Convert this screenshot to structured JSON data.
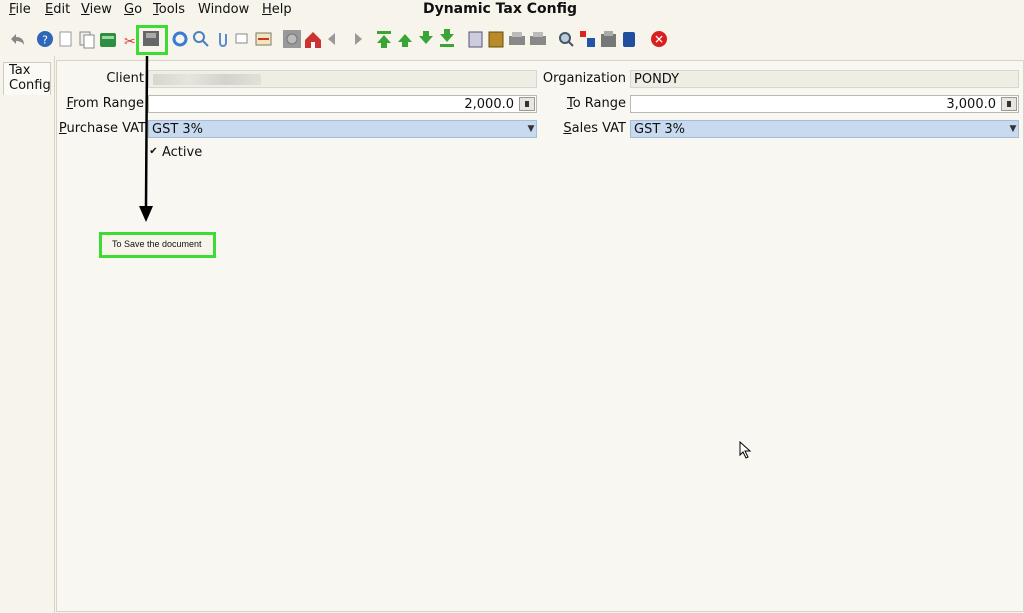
{
  "menubar": {
    "items": [
      {
        "u": "F",
        "rest": "ile"
      },
      {
        "u": "E",
        "rest": "dit"
      },
      {
        "u": "V",
        "rest": "iew"
      },
      {
        "u": "G",
        "rest": "o"
      },
      {
        "u": "T",
        "rest": "ools"
      },
      {
        "u": "",
        "rest": "Window"
      },
      {
        "u": "H",
        "rest": "elp"
      }
    ],
    "title": "Dynamic Tax Config"
  },
  "sidebar": {
    "tab_line1": "Tax",
    "tab_line2": "Config"
  },
  "form": {
    "client_label": "Client",
    "organization_label": "Organization",
    "organization_value": "PONDY",
    "from_range_u": "F",
    "from_range_rest": "rom Range",
    "from_range_value": "2,000.0",
    "to_range_u": "T",
    "to_range_rest": "o Range",
    "to_range_value": "3,000.0",
    "purchase_vat_u": "P",
    "purchase_vat_rest": "urchase VAT",
    "purchase_vat_value": "GST 3%",
    "sales_vat_u": "S",
    "sales_vat_rest": "ales VAT",
    "sales_vat_value": "GST 3%",
    "active_label": "Active",
    "active_checked": true
  },
  "annotation": {
    "text": "To Save the document"
  },
  "colors": {
    "highlight": "#3ddc35",
    "field_blue": "#c8daf0",
    "background": "#f7f4ec"
  }
}
